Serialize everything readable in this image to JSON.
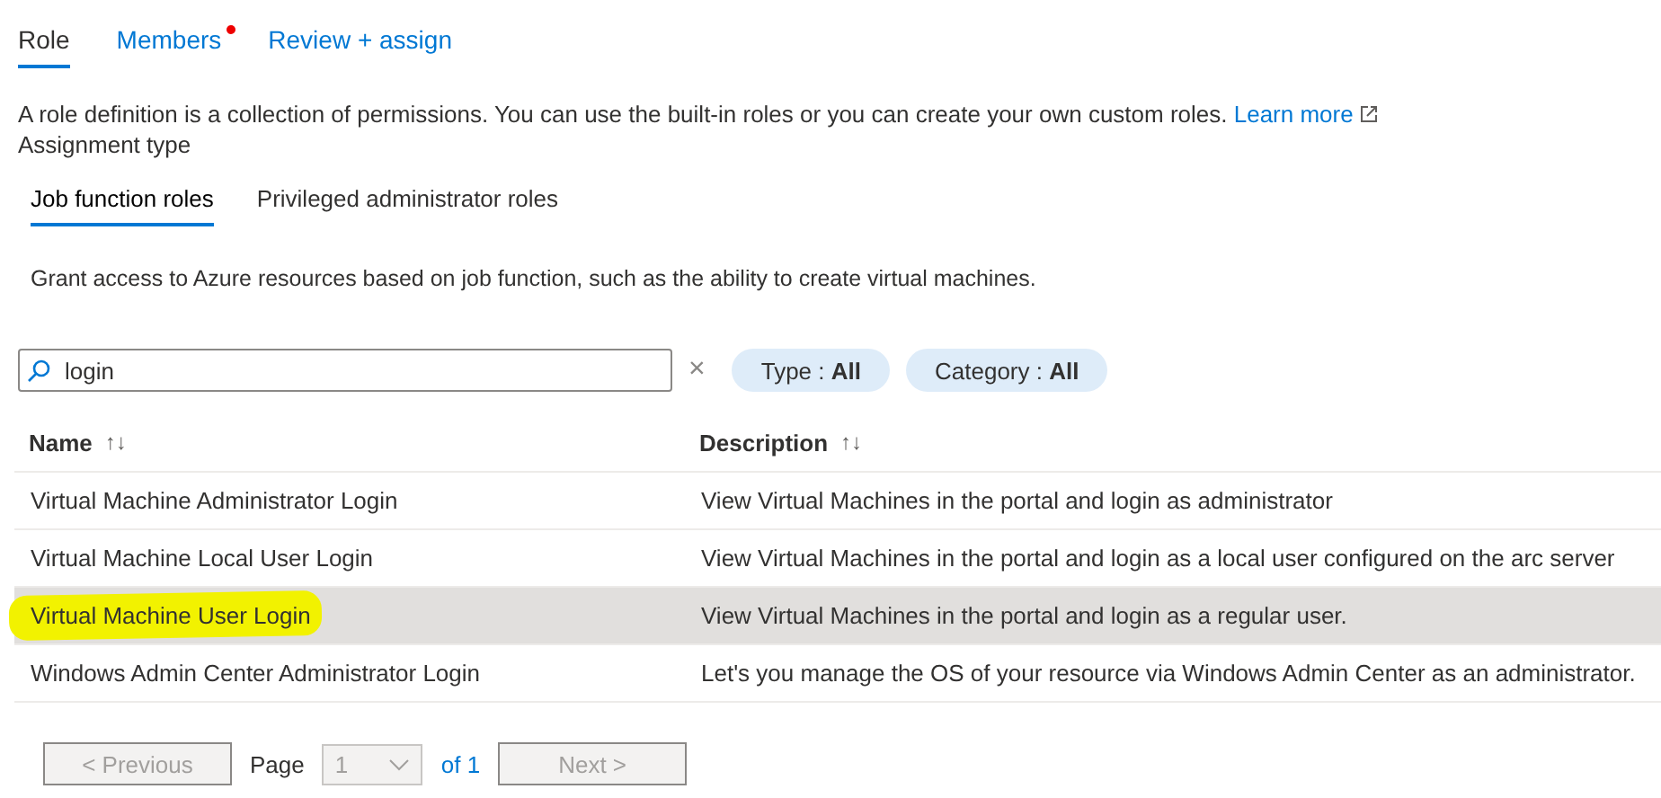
{
  "tabs": [
    {
      "label": "Role",
      "selected": true,
      "attention": false
    },
    {
      "label": "Members",
      "selected": false,
      "attention": true
    },
    {
      "label": "Review + assign",
      "selected": false,
      "attention": false
    }
  ],
  "intro": {
    "text": "A role definition is a collection of permissions. You can use the built-in roles or you can create your own custom roles.",
    "link": "Learn more"
  },
  "assignment_type_label": "Assignment type",
  "subtabs": [
    {
      "label": "Job function roles",
      "selected": true
    },
    {
      "label": "Privileged administrator roles",
      "selected": false
    }
  ],
  "subtab_description": "Grant access to Azure resources based on job function, such as the ability to create virtual machines.",
  "search": {
    "value": "login",
    "clear": "×"
  },
  "filters": [
    {
      "label": "Type : ",
      "value": "All"
    },
    {
      "label": "Category : ",
      "value": "All"
    }
  ],
  "table": {
    "columns": [
      {
        "label": "Name",
        "sort": "↑↓"
      },
      {
        "label": "Description",
        "sort": "↑↓"
      }
    ],
    "rows": [
      {
        "name": "Virtual Machine Administrator Login",
        "description": "View Virtual Machines in the portal and login as administrator",
        "selected": false,
        "highlighted": false
      },
      {
        "name": "Virtual Machine Local User Login",
        "description": "View Virtual Machines in the portal and login as a local user configured on the arc server",
        "selected": false,
        "highlighted": false
      },
      {
        "name": "Virtual Machine User Login",
        "description": "View Virtual Machines in the portal and login as a regular user.",
        "selected": true,
        "highlighted": true
      },
      {
        "name": "Windows Admin Center Administrator Login",
        "description": "Let's you manage the OS of your resource via Windows Admin Center as an administrator.",
        "selected": false,
        "highlighted": false
      }
    ]
  },
  "pagination": {
    "previous": "< Previous",
    "page_label": "Page",
    "page": "1",
    "of": "of 1",
    "next": "Next >",
    "previous_disabled": true,
    "next_disabled": true
  }
}
